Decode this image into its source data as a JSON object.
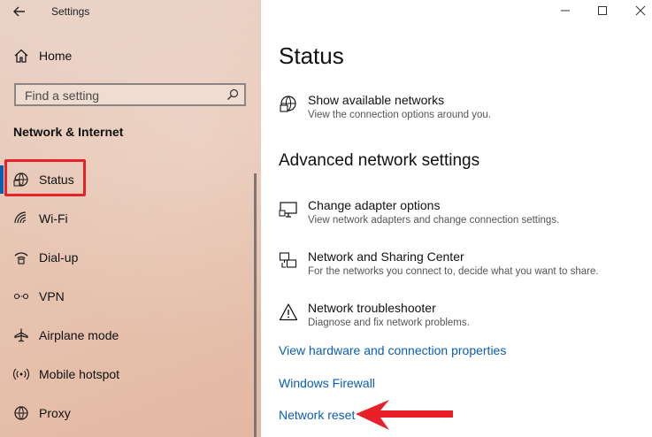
{
  "window": {
    "app_title": "Settings",
    "back_icon": "back-arrow-icon",
    "controls": [
      "minimize-icon",
      "maximize-icon",
      "close-icon"
    ]
  },
  "sidebar": {
    "home_label": "Home",
    "search_placeholder": "Find a setting",
    "section_heading": "Network & Internet",
    "items": [
      {
        "label": "Status",
        "icon": "globe-network-icon",
        "active": true
      },
      {
        "label": "Wi-Fi",
        "icon": "wifi-icon"
      },
      {
        "label": "Dial-up",
        "icon": "dialup-icon"
      },
      {
        "label": "VPN",
        "icon": "vpn-icon"
      },
      {
        "label": "Airplane mode",
        "icon": "airplane-icon"
      },
      {
        "label": "Mobile hotspot",
        "icon": "hotspot-icon"
      },
      {
        "label": "Proxy",
        "icon": "globe-icon"
      }
    ]
  },
  "main": {
    "title": "Status",
    "show_networks": {
      "title": "Show available networks",
      "desc": "View the connection options around you."
    },
    "advanced_heading": "Advanced network settings",
    "advanced_items": [
      {
        "title": "Change adapter options",
        "desc": "View network adapters and change connection settings.",
        "icon": "monitor-icon"
      },
      {
        "title": "Network and Sharing Center",
        "desc": "For the networks you connect to, decide what you want to share.",
        "icon": "sharing-center-icon"
      },
      {
        "title": "Network troubleshooter",
        "desc": "Diagnose and fix network problems.",
        "icon": "warning-icon"
      }
    ],
    "links": [
      "View hardware and connection properties",
      "Windows Firewall",
      "Network reset"
    ]
  },
  "colors": {
    "accent": "#0063b1",
    "link": "#0a5ead",
    "annotation_red": "#e8202a"
  }
}
